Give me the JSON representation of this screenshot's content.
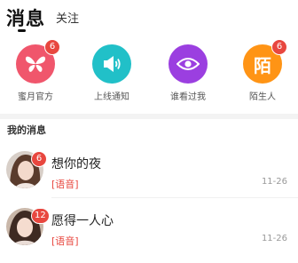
{
  "header": {
    "tab_messages": "消息",
    "tab_follow": "关注"
  },
  "quick_actions": [
    {
      "label": "蜜月官方",
      "icon": "butterfly-icon",
      "color": "#f0566c",
      "badge": "6"
    },
    {
      "label": "上线通知",
      "icon": "speaker-icon",
      "color": "#21c0c8",
      "badge": ""
    },
    {
      "label": "谁看过我",
      "icon": "eye-icon",
      "color": "#9b3fe0",
      "badge": ""
    },
    {
      "label": "陌生人",
      "icon": "stranger-icon",
      "icon_text": "陌",
      "color": "#ff9415",
      "badge": "6"
    }
  ],
  "section": {
    "my_messages": "我的消息"
  },
  "conversations": [
    {
      "name": "想你的夜",
      "badge": "6",
      "message": "[语音]",
      "time": "11-26"
    },
    {
      "name": "愿得一人心",
      "badge": "12",
      "message": "[语音]",
      "time": "11-26"
    }
  ],
  "colors": {
    "badge": "#e8473f",
    "accent": "#e8473f"
  }
}
